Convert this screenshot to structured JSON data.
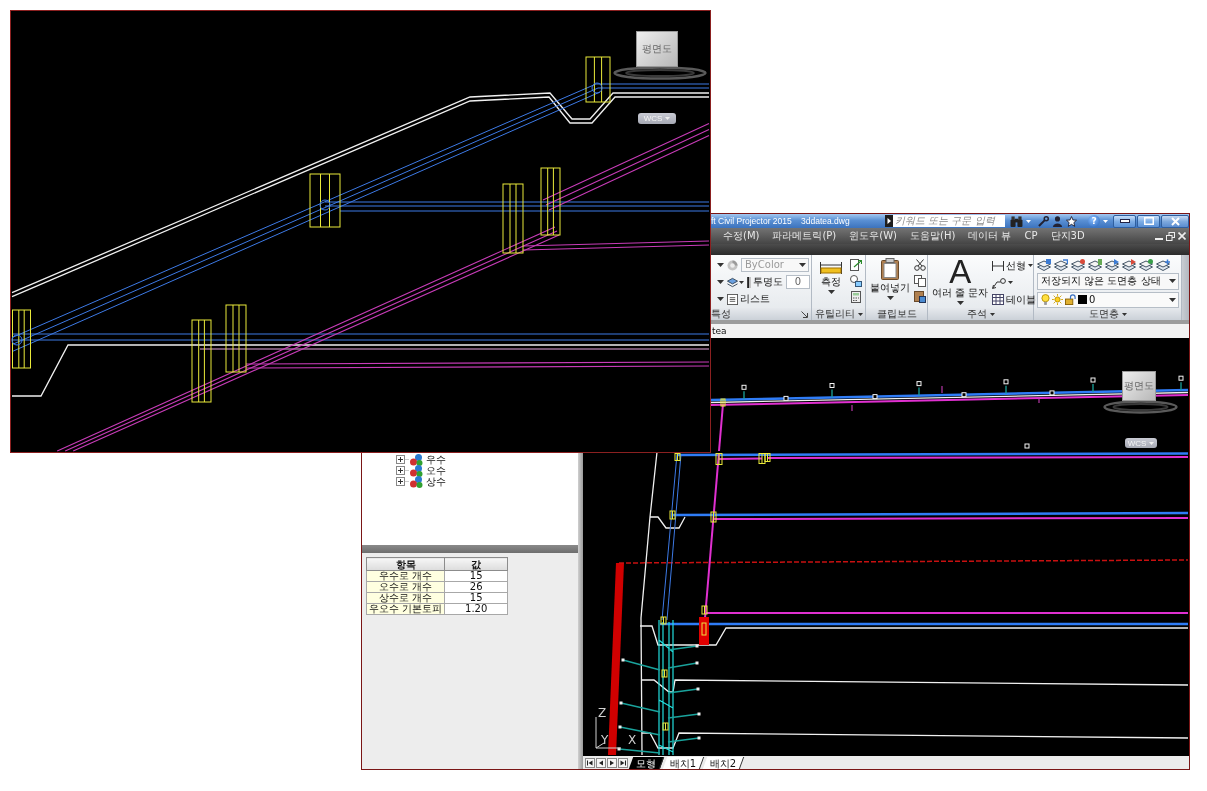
{
  "zoomed_view": {
    "viewcube": {
      "label": "평면도"
    },
    "wcs": {
      "label": "WCS"
    }
  },
  "window": {
    "title": "ft Civil Projector 2015",
    "file": "3ddatea.dwg",
    "search": {
      "placeholder": "키워드 또는 구문 입력"
    },
    "help": "?"
  },
  "menu": [
    "수정(M)",
    "파라메트릭(P)",
    "윈도우(W)",
    "도움말(H)",
    "데이터 뷰",
    "CP",
    "단지3D"
  ],
  "ribbon": {
    "panels": [
      {
        "kind": "properties",
        "title": "특성",
        "menu": false,
        "launcher": true,
        "color_value": "ByColor",
        "color_disabled": true,
        "transparency_label": "투명도",
        "transparency": "0",
        "list_label": "리스트"
      },
      {
        "kind": "utilities",
        "title": "유틸리티",
        "menu": true,
        "launcher": false,
        "button": "측정"
      },
      {
        "kind": "clipboard",
        "title": "클립보드",
        "menu": false,
        "launcher": false,
        "button": "붙여넣기"
      },
      {
        "kind": "annotation",
        "title": "주석",
        "menu": true,
        "launcher": false,
        "glyph": "A",
        "button": "여러 줄 문자",
        "items": [
          {
            "kind": "dimension",
            "label": "선형",
            "menu": true
          },
          {
            "kind": "leader",
            "menu": true
          },
          {
            "kind": "table",
            "label": "테이블",
            "menu": false
          }
        ]
      },
      {
        "kind": "layers",
        "title": "도면층",
        "menu": true,
        "launcher": false,
        "layer_state": "저장되지 않은 도면층 상태",
        "layer": "0"
      }
    ]
  },
  "file_tab": {
    "label": "tea"
  },
  "viewport": {
    "viewcube": {
      "label": "평면도"
    },
    "wcs": {
      "label": "WCS"
    },
    "ucs_axes": [
      "Z",
      "Y",
      "X"
    ]
  },
  "layout_tabs": [
    {
      "label": "모형",
      "selected": true
    },
    {
      "label": "배치1",
      "selected": false
    },
    {
      "label": "배치2",
      "selected": false
    }
  ],
  "tree": [
    {
      "label": "우수",
      "expanded": false
    },
    {
      "label": "오수",
      "expanded": false
    },
    {
      "label": "상수",
      "expanded": false
    }
  ],
  "table": {
    "columns": [
      "항목",
      "값"
    ],
    "rows": [
      [
        "우수로 개수",
        "15"
      ],
      [
        "오수로 개수",
        "26"
      ],
      [
        "상수로 개수",
        "15"
      ],
      [
        "우오수 기본토피",
        "1.20"
      ]
    ]
  }
}
